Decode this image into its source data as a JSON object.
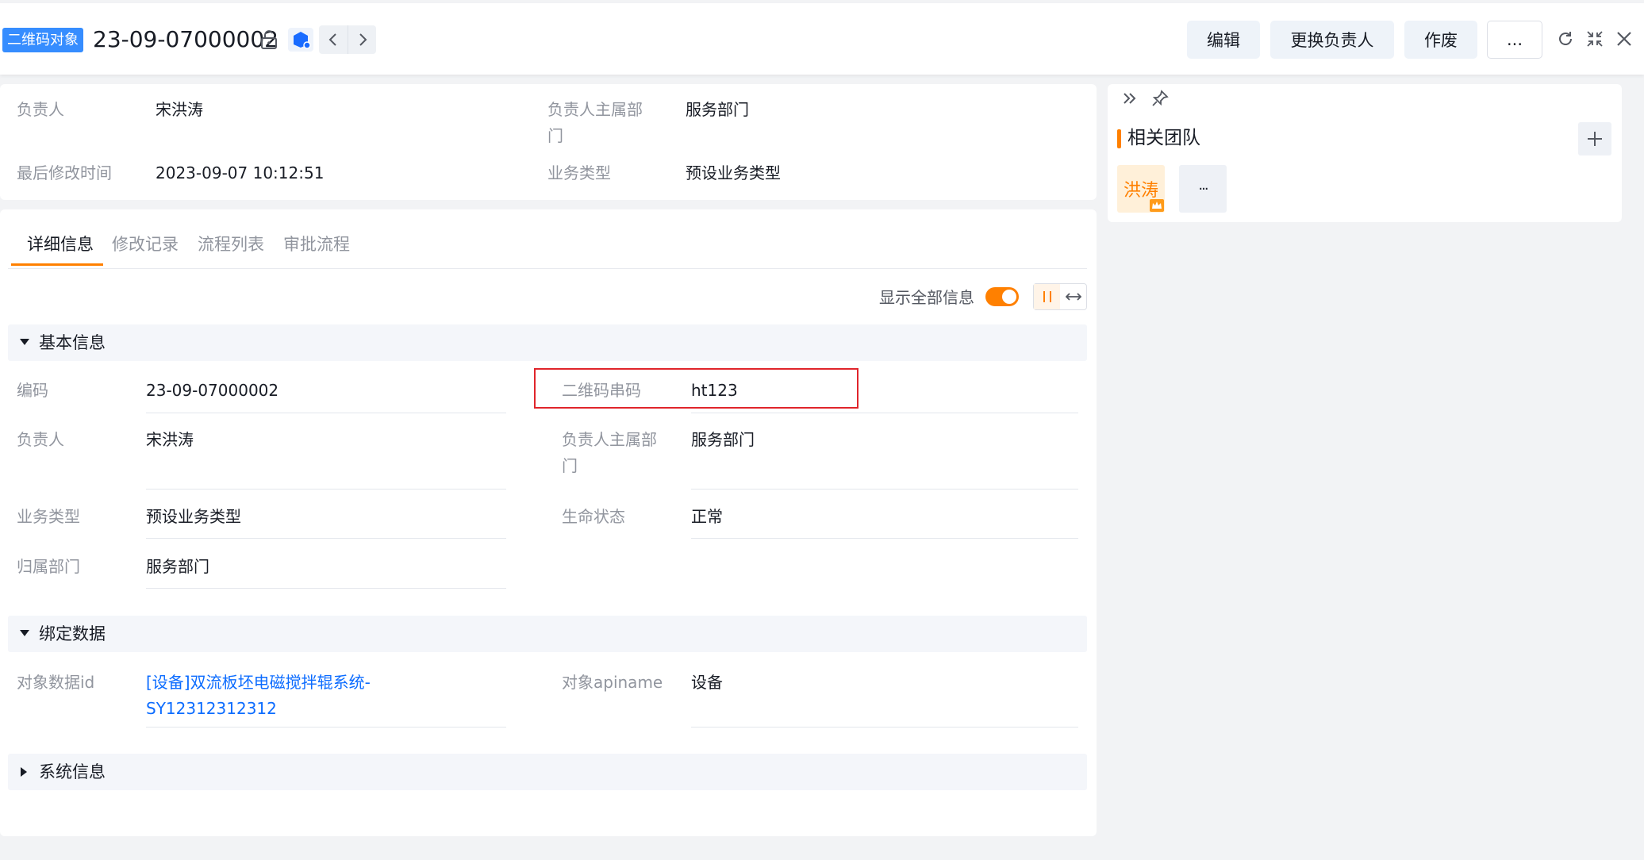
{
  "header": {
    "object_tag": "二维码对象",
    "record_id": "23-09-07000002",
    "buttons": {
      "edit": "编辑",
      "change_owner": "更换负责人",
      "void": "作废",
      "more": "..."
    }
  },
  "summary": {
    "owner_label": "负责人",
    "owner_value": "宋洪涛",
    "owner_dept_label_1": "负责人主属部",
    "owner_dept_label_2": "门",
    "owner_dept_value": "服务部门",
    "modified_label": "最后修改时间",
    "modified_value": "2023-09-07 10:12:51",
    "biz_type_label": "业务类型",
    "biz_type_value": "预设业务类型"
  },
  "tabs": [
    "详细信息",
    "修改记录",
    "流程列表",
    "审批流程"
  ],
  "display": {
    "show_all_label": "显示全部信息",
    "show_all_on": true
  },
  "sections": {
    "basic": {
      "title": "基本信息",
      "code_label": "编码",
      "code_value": "23-09-07000002",
      "qr_label": "二维码串码",
      "qr_value": "ht123",
      "owner_label": "负责人",
      "owner_value": "宋洪涛",
      "owner_dept_label_1": "负责人主属部",
      "owner_dept_label_2": "门",
      "owner_dept_value": "服务部门",
      "biz_type_label": "业务类型",
      "biz_type_value": "预设业务类型",
      "lifecycle_label": "生命状态",
      "lifecycle_value": "正常",
      "dept_label": "归属部门",
      "dept_value": "服务部门"
    },
    "binding": {
      "title": "绑定数据",
      "obj_id_label": "对象数据id",
      "obj_id_value_1": "[设备]双流板坯电磁搅拌辊系统-",
      "obj_id_value_2": "SY12312312312",
      "apiname_label": "对象apiname",
      "apiname_value": "设备"
    },
    "system": {
      "title": "系统信息"
    }
  },
  "team": {
    "title": "相关团队",
    "members": [
      "洪涛"
    ],
    "more": "···"
  },
  "colors": {
    "accent": "#ff8000",
    "link": "#0c6cff",
    "tag": "#368dff",
    "highlight": "#e0252b"
  }
}
